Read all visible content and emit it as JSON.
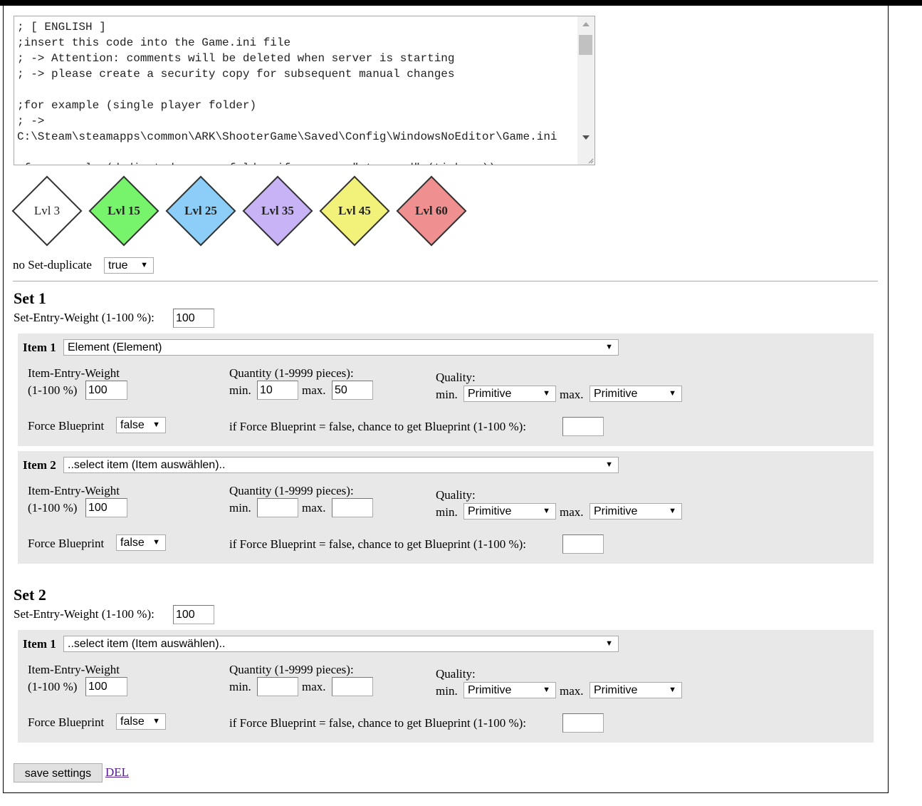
{
  "code_lines": [
    "; [ ENGLISH ]",
    ";insert this code into the Game.ini file",
    "; -> Attention: comments will be deleted when server is starting",
    "; -> please create a security copy for subsequent manual changes",
    "",
    ";for example (single player folder)",
    "; ->",
    "C:\\Steam\\steamapps\\common\\ARK\\ShooterGame\\Saved\\Config\\WindowsNoEditor\\Game.ini",
    "",
    ";for example (dedicated server folder if you use \"steamcmd\" (tinkery))"
  ],
  "levels": [
    {
      "label": "Lvl 3",
      "color": "#ffffff",
      "bold": false
    },
    {
      "label": "Lvl 15",
      "color": "#77f46c",
      "bold": true
    },
    {
      "label": "Lvl 25",
      "color": "#8ccef8",
      "bold": true
    },
    {
      "label": "Lvl 35",
      "color": "#c9b3f7",
      "bold": true
    },
    {
      "label": "Lvl 45",
      "color": "#f2f27a",
      "bold": true
    },
    {
      "label": "Lvl 60",
      "color": "#f08f8f",
      "bold": true
    }
  ],
  "no_set_duplicate": {
    "label": "no Set-duplicate",
    "value": "true"
  },
  "sets": [
    {
      "title": "Set 1",
      "weight_label": "Set-Entry-Weight (1-100 %):",
      "weight": "100",
      "items": [
        {
          "label": "Item 1",
          "selected": "Element (Element)",
          "weight_label_1": "Item-Entry-Weight",
          "weight_label_2": "(1-100 %)",
          "weight": "100",
          "qty_label": "Quantity (1-9999 pieces):",
          "min_label": "min.",
          "max_label": "max.",
          "qty_min": "10",
          "qty_max": "50",
          "quality_label": "Quality:",
          "quality_min": "Primitive",
          "quality_max": "Primitive",
          "fb_label": "Force Blueprint",
          "fb_value": "false",
          "chance_label": "if Force Blueprint = false, chance to get Blueprint (1-100 %):",
          "chance": ""
        },
        {
          "label": "Item 2",
          "selected": "..select item (Item auswählen)..",
          "weight_label_1": "Item-Entry-Weight",
          "weight_label_2": "(1-100 %)",
          "weight": "100",
          "qty_label": "Quantity (1-9999 pieces):",
          "min_label": "min.",
          "max_label": "max.",
          "qty_min": "",
          "qty_max": "",
          "quality_label": "Quality:",
          "quality_min": "Primitive",
          "quality_max": "Primitive",
          "fb_label": "Force Blueprint",
          "fb_value": "false",
          "chance_label": "if Force Blueprint = false, chance to get Blueprint (1-100 %):",
          "chance": ""
        }
      ]
    },
    {
      "title": "Set 2",
      "weight_label": "Set-Entry-Weight (1-100 %):",
      "weight": "100",
      "items": [
        {
          "label": "Item 1",
          "selected": "..select item (Item auswählen)..",
          "weight_label_1": "Item-Entry-Weight",
          "weight_label_2": "(1-100 %)",
          "weight": "100",
          "qty_label": "Quantity (1-9999 pieces):",
          "min_label": "min.",
          "max_label": "max.",
          "qty_min": "",
          "qty_max": "",
          "quality_label": "Quality:",
          "quality_min": "Primitive",
          "quality_max": "Primitive",
          "fb_label": "Force Blueprint",
          "fb_value": "false",
          "chance_label": "if Force Blueprint = false, chance to get Blueprint (1-100 %):",
          "chance": ""
        }
      ]
    }
  ],
  "actions": {
    "save_label": "save settings",
    "del_label": "DEL"
  },
  "icons": {
    "dropdown": "caret-down-icon",
    "scroll_up": "scroll-up-icon",
    "scroll_down": "scroll-down-icon",
    "resize": "resize-grip-icon"
  },
  "glyphs": {
    "caret": "▼"
  }
}
